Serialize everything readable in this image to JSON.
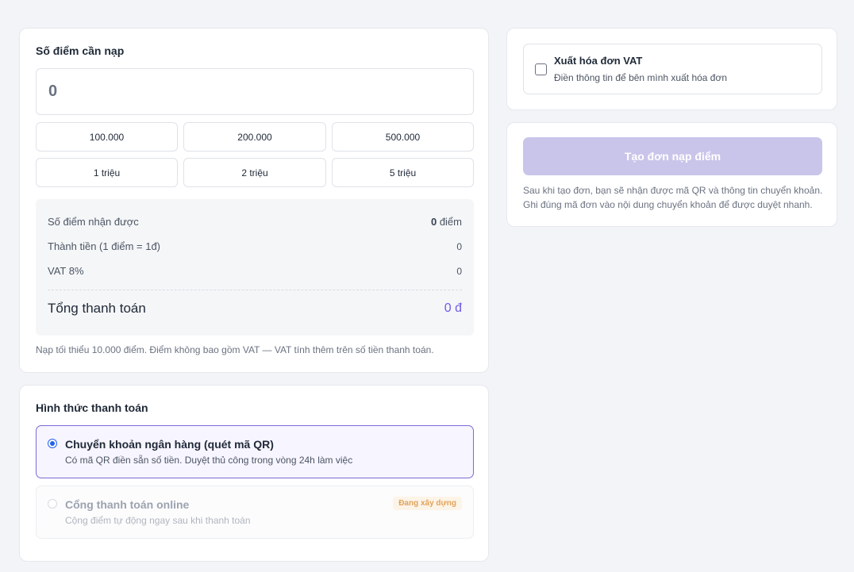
{
  "topup": {
    "title": "Số điểm cần nạp",
    "amount_value": "",
    "amount_placeholder": "0",
    "presets": [
      "100.000",
      "200.000",
      "500.000",
      "1 triệu",
      "2 triệu",
      "5 triệu"
    ],
    "summary": {
      "received_label": "Số điểm nhận được",
      "received_value": "0",
      "received_unit": " điểm",
      "amount_label": "Thành tiền (1 điểm = 1đ)",
      "amount_value": "0",
      "vat_label": "VAT 8%",
      "vat_value": "0",
      "total_label": "Tổng thanh toán",
      "total_value": "0 đ"
    },
    "hint": "Nạp tối thiểu 10.000 điểm. Điểm không bao gồm VAT — VAT tính thêm trên số tiền thanh toán."
  },
  "payment": {
    "title": "Hình thức thanh toán",
    "options": [
      {
        "title": "Chuyển khoản ngân hàng (quét mã QR)",
        "description": "Có mã QR điền sẵn số tiền. Duyệt thủ công trong vòng 24h làm việc",
        "selected": true
      },
      {
        "title": "Cổng thanh toán online",
        "description": "Cộng điểm tự động ngay sau khi thanh toán",
        "badge": "Đang xây dựng",
        "disabled": true
      }
    ]
  },
  "vat_invoice": {
    "title": "Xuất hóa đơn VAT",
    "description": "Điền thông tin để bên mình xuất hóa đơn",
    "checked": false
  },
  "order": {
    "button_label": "Tạo đơn nạp điểm",
    "note_line1": "Sau khi tạo đơn, bạn sẽ nhận được mã QR và thông tin chuyển khoản.",
    "note_line2": "Ghi đúng mã đơn vào nội dung chuyển khoản để được duyệt nhanh."
  },
  "colors": {
    "accent": "#6d5ce8",
    "selected_border": "#7c6ad8",
    "button_disabled": "#c9c5ea",
    "badge_text": "#e0a35a"
  }
}
